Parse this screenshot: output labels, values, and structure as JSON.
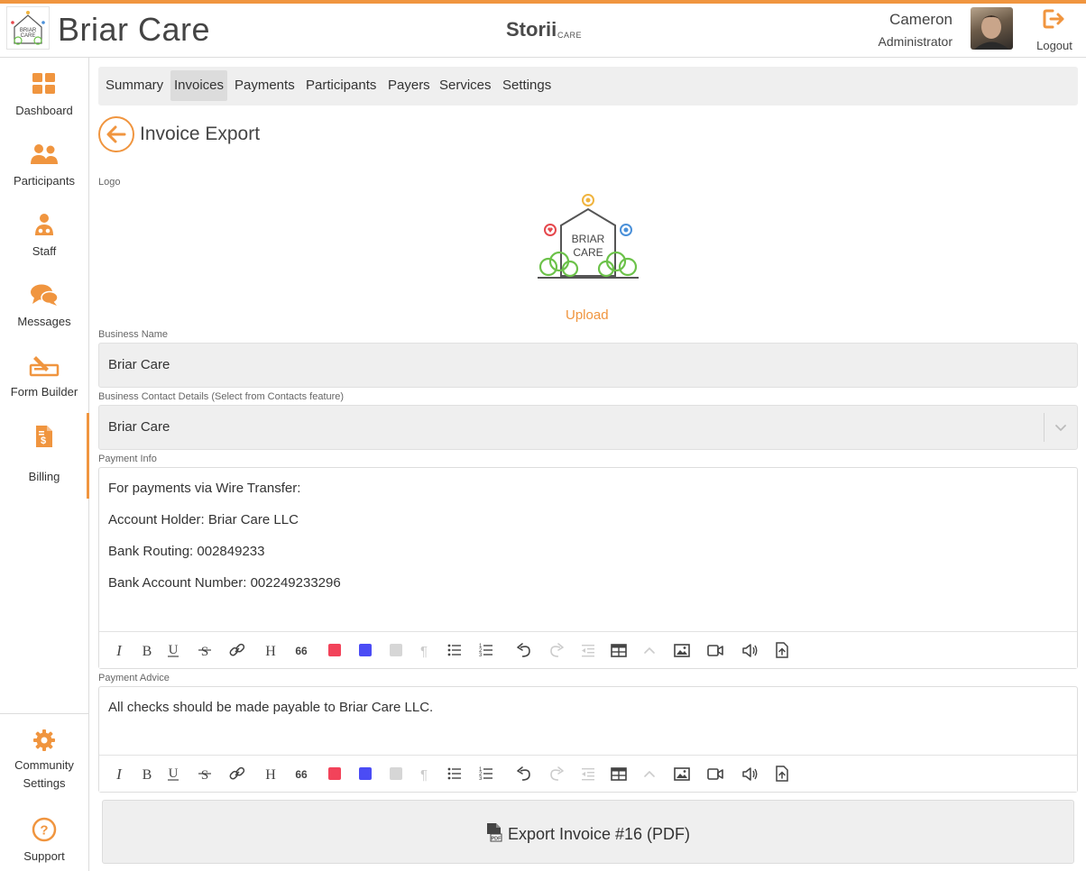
{
  "header": {
    "app_title": "Briar Care",
    "brand_name": "Storii",
    "brand_sub": "CARE",
    "user_name": "Cameron",
    "user_role": "Administrator",
    "logout_label": "Logout",
    "logo_text_line1": "BRIAR",
    "logo_text_line2": "CARE"
  },
  "sidebar": {
    "items": [
      {
        "label": "Dashboard",
        "icon": "grid-icon"
      },
      {
        "label": "Participants",
        "icon": "people-icon"
      },
      {
        "label": "Staff",
        "icon": "staff-icon"
      },
      {
        "label": "Messages",
        "icon": "chat-icon"
      },
      {
        "label": "Form Builder",
        "icon": "form-builder-icon"
      },
      {
        "label": "Billing",
        "icon": "billing-icon",
        "active": true
      }
    ],
    "bottom_items": [
      {
        "label_line1": "Community",
        "label_line2": "Settings",
        "icon": "gear-icon"
      },
      {
        "label": "Support",
        "icon": "help-icon"
      }
    ]
  },
  "tabs": [
    {
      "label": "Summary"
    },
    {
      "label": "Invoices",
      "active": true
    },
    {
      "label": "Payments"
    },
    {
      "label": "Participants"
    },
    {
      "label": "Payers"
    },
    {
      "label": "Services"
    },
    {
      "label": "Settings"
    }
  ],
  "page": {
    "title": "Invoice Export",
    "logo_label": "Logo",
    "logo_text_line1": "BRIAR",
    "logo_text_line2": "CARE",
    "upload_label": "Upload",
    "business_name_label": "Business Name",
    "business_name_value": "Briar Care",
    "contact_label": "Business Contact Details (Select from Contacts feature)",
    "contact_value": "Briar Care",
    "payment_info_label": "Payment Info",
    "payment_info_lines": [
      "For payments via Wire Transfer:",
      "Account Holder: Briar Care LLC",
      "Bank Routing: 002849233",
      "Bank Account Number: 002249233296"
    ],
    "payment_advice_label": "Payment Advice",
    "payment_advice_text": "All checks should be made payable to Briar Care LLC.",
    "export_button_label": "Export Invoice #16 (PDF)"
  },
  "toolbar_icons": [
    "italic-icon",
    "bold-icon",
    "underline-icon",
    "strikethrough-icon",
    "link-icon",
    "heading-icon",
    "quote-icon",
    "red-swatch",
    "blue-swatch",
    "gray-swatch",
    "paragraph-icon",
    "bullet-list-icon",
    "numbered-list-icon",
    "undo-icon",
    "redo-icon",
    "outdent-icon",
    "table-icon",
    "collapse-icon",
    "image-icon",
    "video-icon",
    "audio-icon",
    "file-upload-icon"
  ],
  "colors": {
    "accent": "#f0953f",
    "swatch_red": "#f2435a",
    "swatch_blue": "#4b4cf5",
    "swatch_gray": "#d6d6d6"
  }
}
